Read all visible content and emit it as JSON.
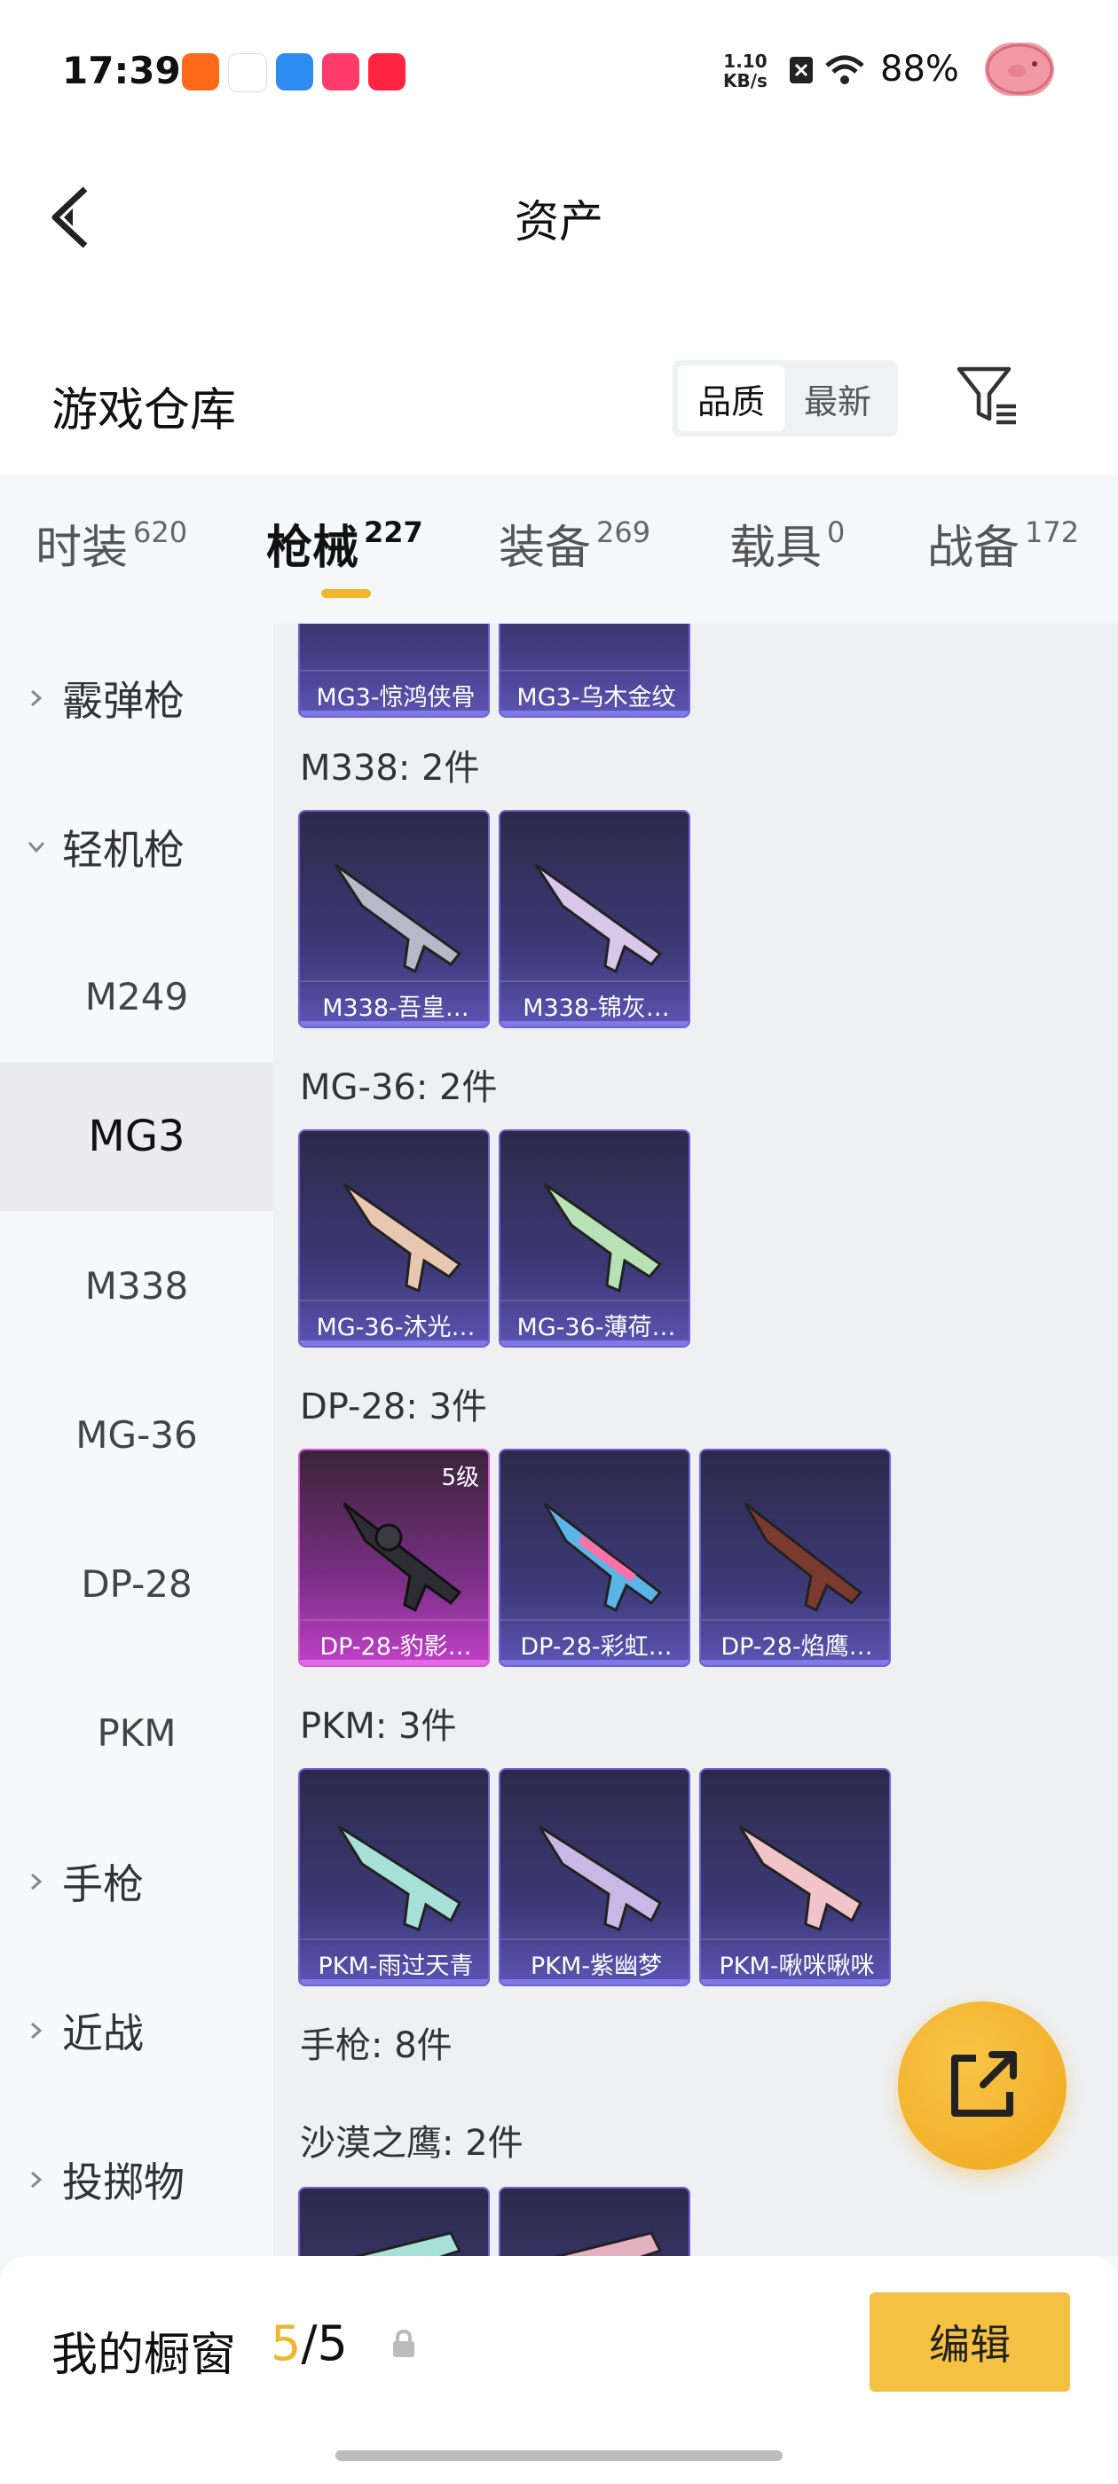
{
  "status_bar": {
    "time": "17:39",
    "net_speed_value": "1.10",
    "net_speed_unit": "KB/s",
    "battery": "88%",
    "icons": [
      "kuaishou-icon",
      "calendar-icon",
      "browser-icon",
      "video-icon",
      "xiaohongshu-icon",
      "sim-icon",
      "wifi-icon",
      "pig-avatar-icon"
    ]
  },
  "header": {
    "title": "资产",
    "back_icon": "chevron-left-icon"
  },
  "warehouse": {
    "title": "游戏仓库",
    "sort_options": [
      "品质",
      "最新"
    ],
    "sort_active": "品质",
    "filter_icon": "filter-icon"
  },
  "tabs": [
    {
      "label": "时装",
      "count": "620"
    },
    {
      "label": "枪械",
      "count": "227",
      "active": true
    },
    {
      "label": "装备",
      "count": "269"
    },
    {
      "label": "载具",
      "count": "0"
    },
    {
      "label": "战备",
      "count": "172"
    }
  ],
  "sidebar": {
    "items": [
      {
        "label": "霰弹枪",
        "type": "category",
        "expanded": false
      },
      {
        "label": "轻机枪",
        "type": "category",
        "expanded": true
      },
      {
        "label": "M249",
        "type": "sub"
      },
      {
        "label": "MG3",
        "type": "sub",
        "selected": true
      },
      {
        "label": "M338",
        "type": "sub"
      },
      {
        "label": "MG-36",
        "type": "sub"
      },
      {
        "label": "DP-28",
        "type": "sub"
      },
      {
        "label": "PKM",
        "type": "sub"
      },
      {
        "label": "手枪",
        "type": "category",
        "expanded": false
      },
      {
        "label": "近战",
        "type": "category",
        "expanded": false
      },
      {
        "label": "投掷物",
        "type": "category",
        "expanded": false
      }
    ]
  },
  "content": {
    "groups": [
      {
        "label": "",
        "items": [
          "MG3-惊鸿侠骨",
          "MG3-乌木金纹"
        ]
      },
      {
        "label": "M338: 2件",
        "items": [
          "M338-吾皇…",
          "M338-锦灰…"
        ]
      },
      {
        "label": "MG-36: 2件",
        "items": [
          "MG-36-沐光…",
          "MG-36-薄荷…"
        ]
      },
      {
        "label": "DP-28: 3件",
        "items": [
          "DP-28-豹影…",
          "DP-28-彩虹…",
          "DP-28-焰鹰…"
        ],
        "first_level": "5级"
      },
      {
        "label": "PKM: 3件",
        "items": [
          "PKM-雨过天青",
          "PKM-紫幽梦",
          "PKM-啾咪啾咪"
        ]
      },
      {
        "label": "手枪: 8件",
        "items": []
      },
      {
        "label": "沙漠之鹰: 2件",
        "items": [
          "",
          ""
        ]
      }
    ],
    "fab_icon": "share-external-icon"
  },
  "bottom_bar": {
    "label": "我的橱窗",
    "count_current": "5",
    "count_total": "/5",
    "lock_icon": "lock-icon",
    "edit_label": "编辑"
  }
}
